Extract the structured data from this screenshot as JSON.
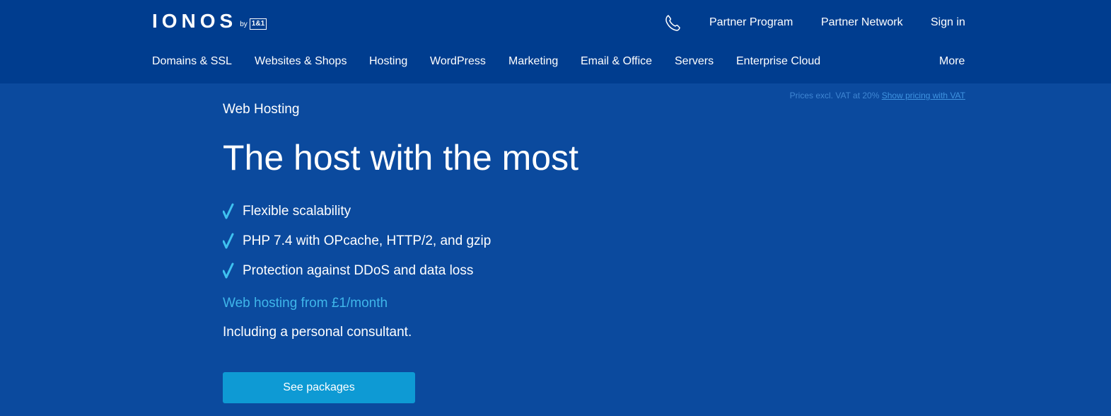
{
  "header": {
    "logo": {
      "wordmark": "IONOS",
      "by": "by",
      "badge": "1&1"
    },
    "top_links": [
      "Partner Program",
      "Partner Network",
      "Sign in"
    ],
    "phone_icon": "phone-icon",
    "nav": [
      "Domains & SSL",
      "Websites & Shops",
      "Hosting",
      "WordPress",
      "Marketing",
      "Email & Office",
      "Servers",
      "Enterprise Cloud"
    ],
    "more": "More"
  },
  "pricing_note": {
    "text": "Prices excl. VAT at 20%",
    "link": "Show pricing with VAT"
  },
  "hero": {
    "eyebrow": "Web Hosting",
    "headline": "The host with the most",
    "features": [
      "Flexible scalability",
      "PHP 7.4 with OPcache, HTTP/2, and gzip",
      "Protection against DDoS and data loss"
    ],
    "price_line": "Web hosting from £1/month",
    "consultant": "Including a personal consultant.",
    "cta": "See packages"
  },
  "colors": {
    "header_bg": "#003d8f",
    "page_bg": "#0b4a9e",
    "accent": "#3fb6ea",
    "button": "#0e9ad4",
    "check": "#3fc2f0"
  }
}
